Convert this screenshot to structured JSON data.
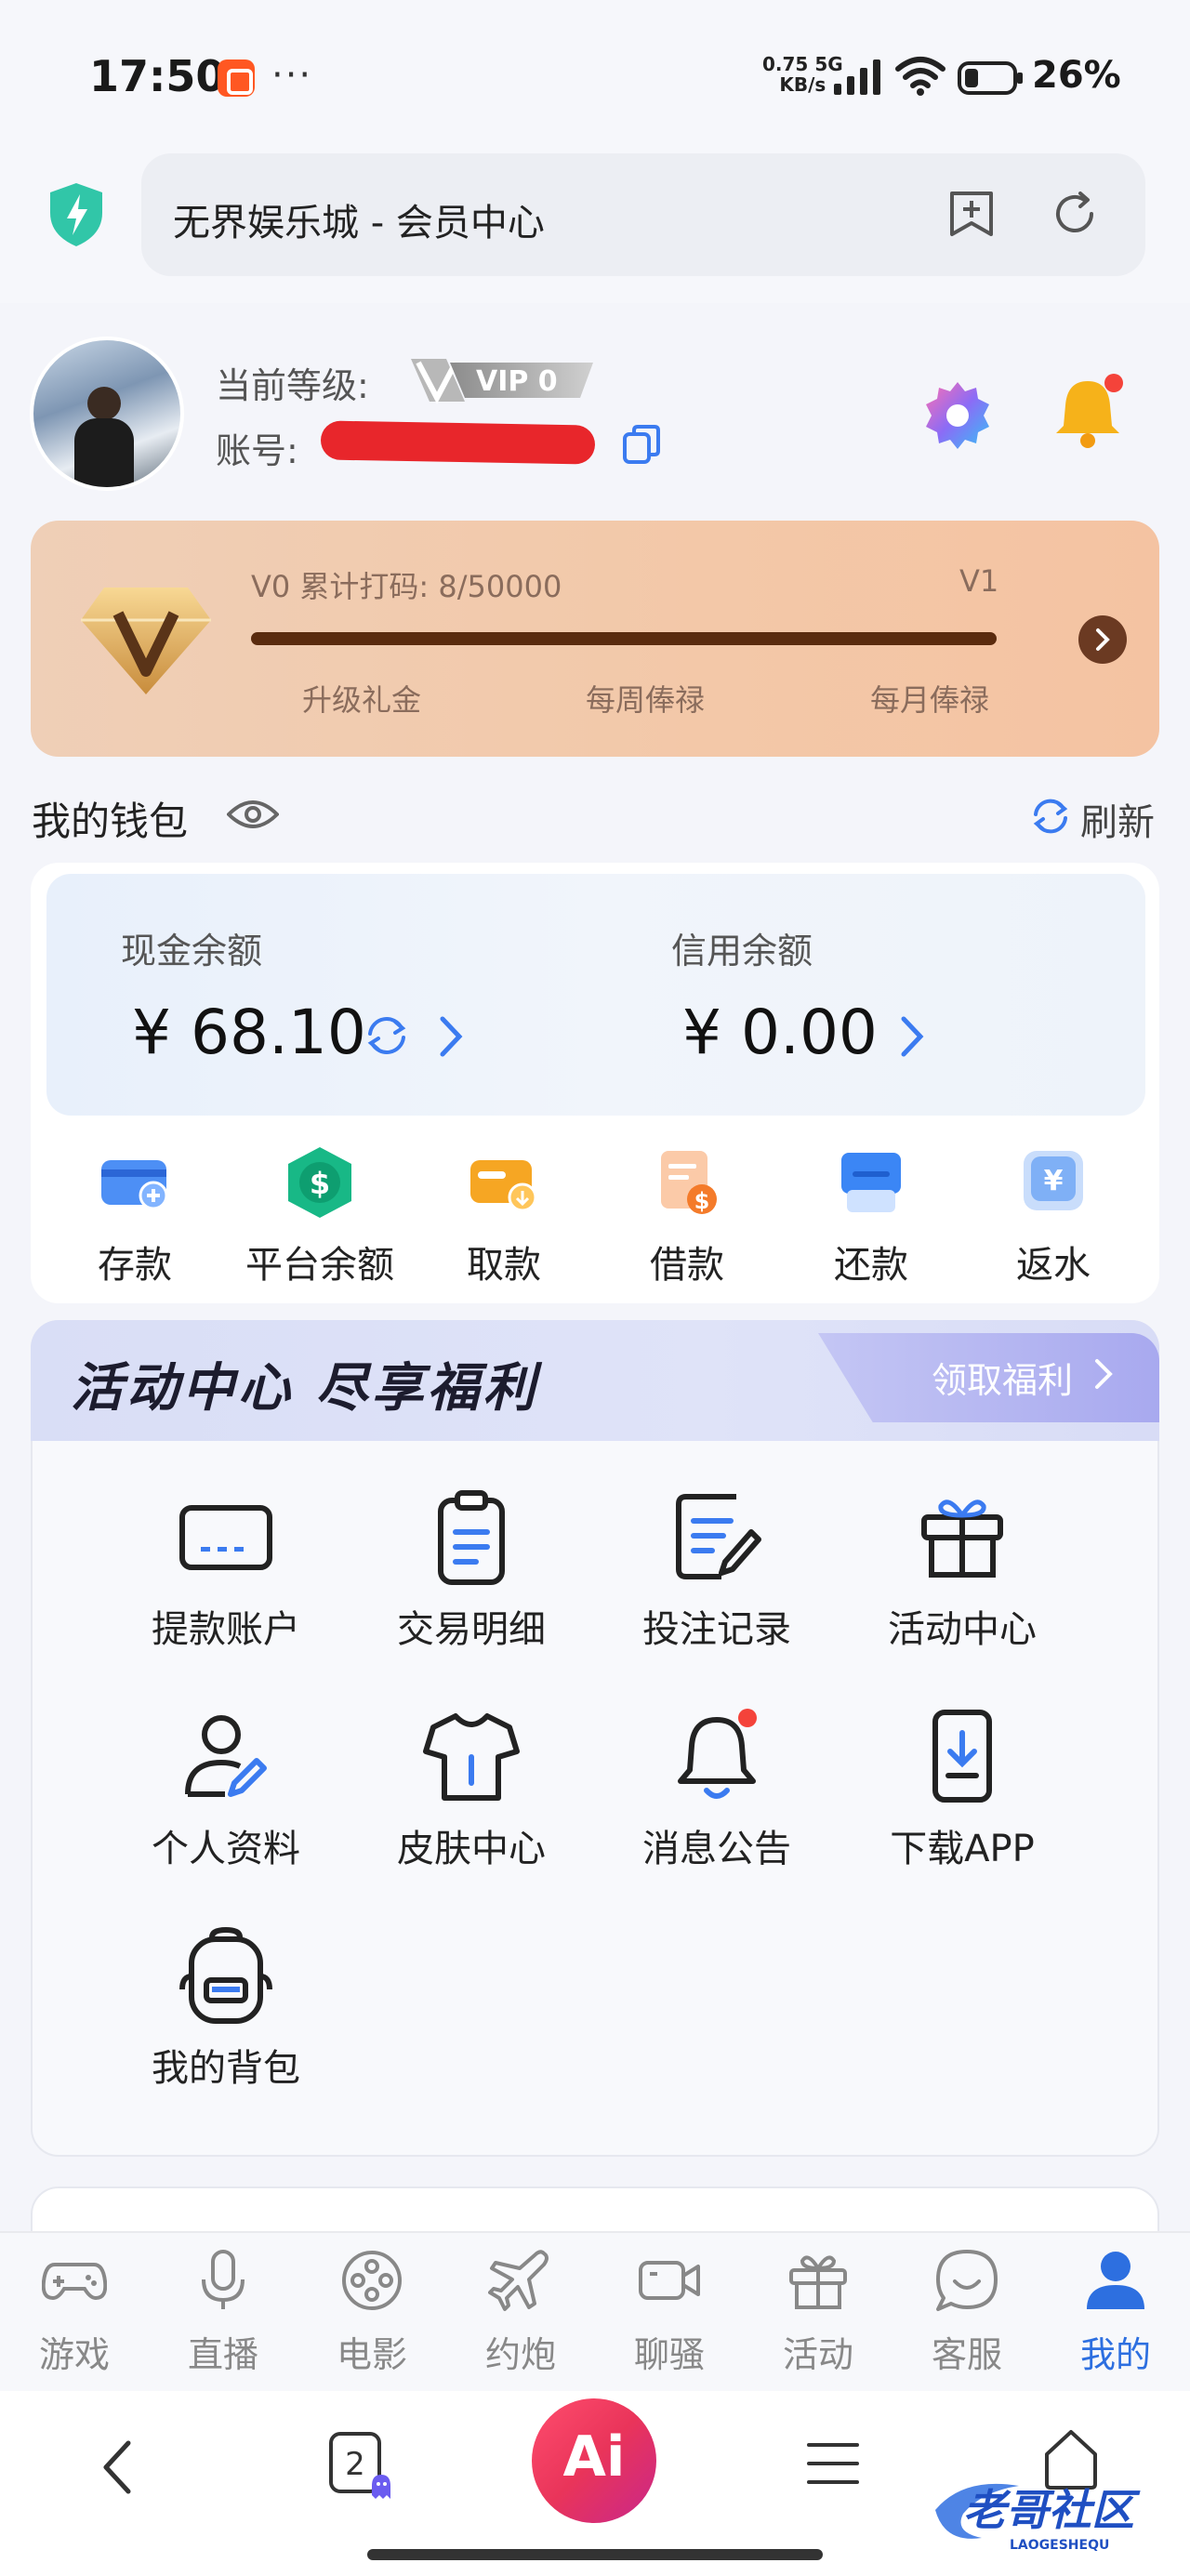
{
  "status_bar": {
    "time": "17:50",
    "speed_value": "0.75",
    "speed_unit": "KB/s",
    "network_type": "5G",
    "battery": "26%"
  },
  "browser": {
    "url_title": "无界娱乐城 - 会员中心",
    "tab_count": "2",
    "ai_label": "Ai"
  },
  "profile": {
    "level_label": "当前等级:",
    "vip_level": "VIP 0",
    "account_label": "账号:"
  },
  "vip_card": {
    "progress_text": "V0 累计打码: 8/50000",
    "next_level": "V1",
    "progress_fraction": 0.00016,
    "perks": [
      "升级礼金",
      "每周俸禄",
      "每月俸禄"
    ]
  },
  "wallet": {
    "title": "我的钱包",
    "refresh_label": "刷新",
    "cash_label": "现金余额",
    "cash_value": "¥ 68.10",
    "credit_label": "信用余额",
    "credit_value": "¥ 0.00",
    "actions": [
      {
        "label": "存款",
        "icon": "deposit-card-icon",
        "color": "#3b82f6"
      },
      {
        "label": "平台余额",
        "icon": "dollar-coin-icon",
        "color": "#10b981"
      },
      {
        "label": "取款",
        "icon": "withdraw-wallet-icon",
        "color": "#f59e0b"
      },
      {
        "label": "借款",
        "icon": "loan-document-icon",
        "color": "#f97316"
      },
      {
        "label": "还款",
        "icon": "repay-card-icon",
        "color": "#3b82f6"
      },
      {
        "label": "返水",
        "icon": "yen-rebate-icon",
        "color": "#60a5fa"
      }
    ]
  },
  "activity": {
    "title": "活动中心 尽享福利",
    "claim_label": "领取福利",
    "items": [
      {
        "label": "提款账户",
        "icon": "bank-card-icon"
      },
      {
        "label": "交易明细",
        "icon": "clipboard-list-icon"
      },
      {
        "label": "投注记录",
        "icon": "edit-document-icon"
      },
      {
        "label": "活动中心",
        "icon": "gift-box-icon"
      },
      {
        "label": "个人资料",
        "icon": "user-edit-icon"
      },
      {
        "label": "皮肤中心",
        "icon": "tshirt-icon"
      },
      {
        "label": "消息公告",
        "icon": "notification-bell-icon"
      },
      {
        "label": "下载APP",
        "icon": "phone-download-icon"
      },
      {
        "label": "我的背包",
        "icon": "backpack-icon"
      }
    ]
  },
  "tabbar": {
    "items": [
      {
        "label": "游戏",
        "icon": "gamepad-icon"
      },
      {
        "label": "直播",
        "icon": "microphone-icon"
      },
      {
        "label": "电影",
        "icon": "film-reel-icon"
      },
      {
        "label": "约炮",
        "icon": "airplane-icon"
      },
      {
        "label": "聊骚",
        "icon": "video-camera-icon"
      },
      {
        "label": "活动",
        "icon": "gift-icon"
      },
      {
        "label": "客服",
        "icon": "chat-bubble-icon"
      },
      {
        "label": "我的",
        "icon": "user-profile-icon"
      }
    ],
    "active_index": 7,
    "active_color": "#2d6fe0"
  },
  "watermark": {
    "text": "老哥社区",
    "subtext": "LAOGESHEQU"
  }
}
